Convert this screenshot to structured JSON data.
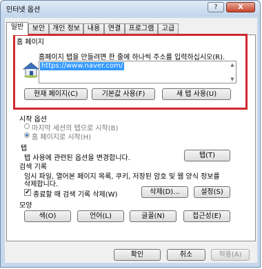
{
  "window": {
    "title": "인터넷 옵션",
    "help": "?",
    "close": "X"
  },
  "tabs": [
    "일반",
    "보안",
    "개인 정보",
    "내용",
    "연결",
    "프로그램",
    "고급"
  ],
  "homepage": {
    "title": "홈 페이지",
    "instruction": "홈페이지 탭을 만들려면 한 줄에 하나씩 주소를 입력하십시오(R).",
    "url": "https://www.naver.com/",
    "buttons": [
      "현재 페이지(C)",
      "기본값 사용(F)",
      "새 탭 사용(U)"
    ]
  },
  "startup": {
    "title": "시작 옵션",
    "option1": "마지막 세션의 탭으로 시작(B)",
    "option2": "홈 페이지로 시작(H)"
  },
  "tabs_section": {
    "title": "탭",
    "desc": "탭 사용에 관련된 옵션을 변경합니다.",
    "button": "탭(T)"
  },
  "history": {
    "title": "검색 기록",
    "desc1": "임시 파일, 열어본 페이지 목록, 쿠키, 저장된 암호 및 웹 양식 정보를",
    "desc2": "삭제합니다.",
    "checkbox": "종료할 때 검색 기록 삭제(W)",
    "delete": "삭제(D)...",
    "settings": "설정(S)"
  },
  "appearance": {
    "title": "모양",
    "buttons": [
      "색(O)",
      "언어(L)",
      "글꼴(N)",
      "접근성(E)"
    ]
  },
  "footer": {
    "ok": "확인",
    "cancel": "취소",
    "apply": "적용(A)"
  }
}
